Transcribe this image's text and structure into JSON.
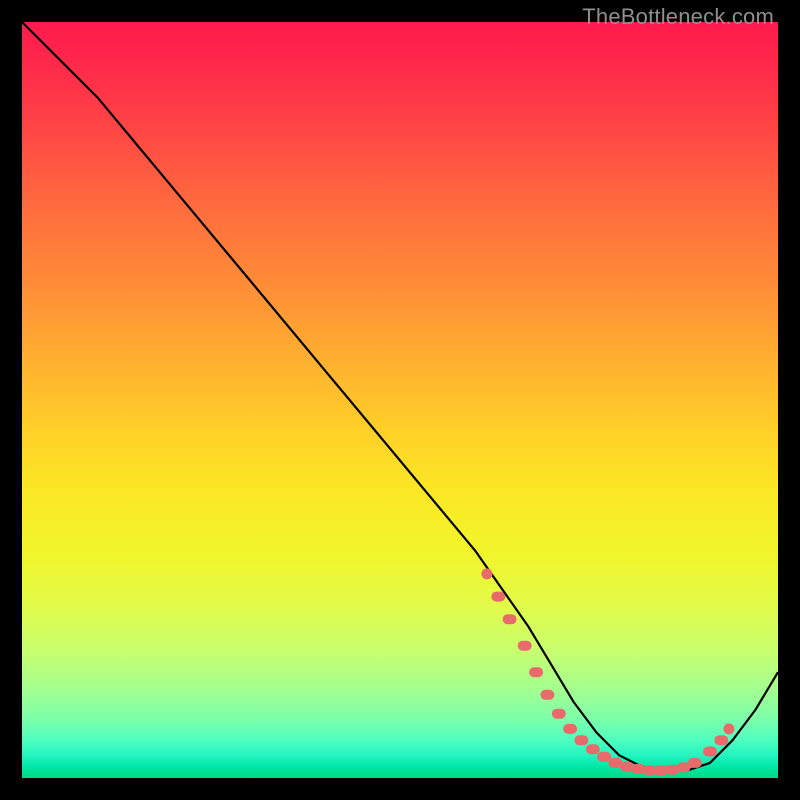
{
  "watermark": "TheBottleneck.com",
  "colors": {
    "dot": "#e86a6a",
    "line": "#000000"
  },
  "chart_data": {
    "type": "line",
    "title": "",
    "xlabel": "",
    "ylabel": "",
    "xlim": [
      0,
      100
    ],
    "ylim": [
      0,
      100
    ],
    "grid": false,
    "legend": false,
    "series": [
      {
        "name": "curve",
        "x": [
          0,
          4,
          10,
          20,
          30,
          40,
          50,
          60,
          67,
          70,
          73,
          76,
          79,
          82,
          85,
          88,
          91,
          94,
          97,
          100
        ],
        "y": [
          100,
          96,
          90,
          78,
          66,
          54,
          42,
          30,
          20,
          15,
          10,
          6,
          3,
          1.5,
          1,
          1,
          2,
          5,
          9,
          14
        ]
      }
    ],
    "highlight_points": {
      "name": "dots",
      "x": [
        63,
        64.5,
        66.5,
        68,
        69.5,
        71,
        72.5,
        74,
        75.5,
        77,
        78.5,
        80,
        81.5,
        83,
        84.5,
        86,
        87.5,
        89,
        91,
        92.5
      ],
      "y": [
        24,
        21,
        17.5,
        14,
        11,
        8.5,
        6.5,
        5,
        3.8,
        2.8,
        2,
        1.5,
        1.2,
        1,
        1,
        1.1,
        1.4,
        2,
        3.5,
        5
      ]
    }
  }
}
